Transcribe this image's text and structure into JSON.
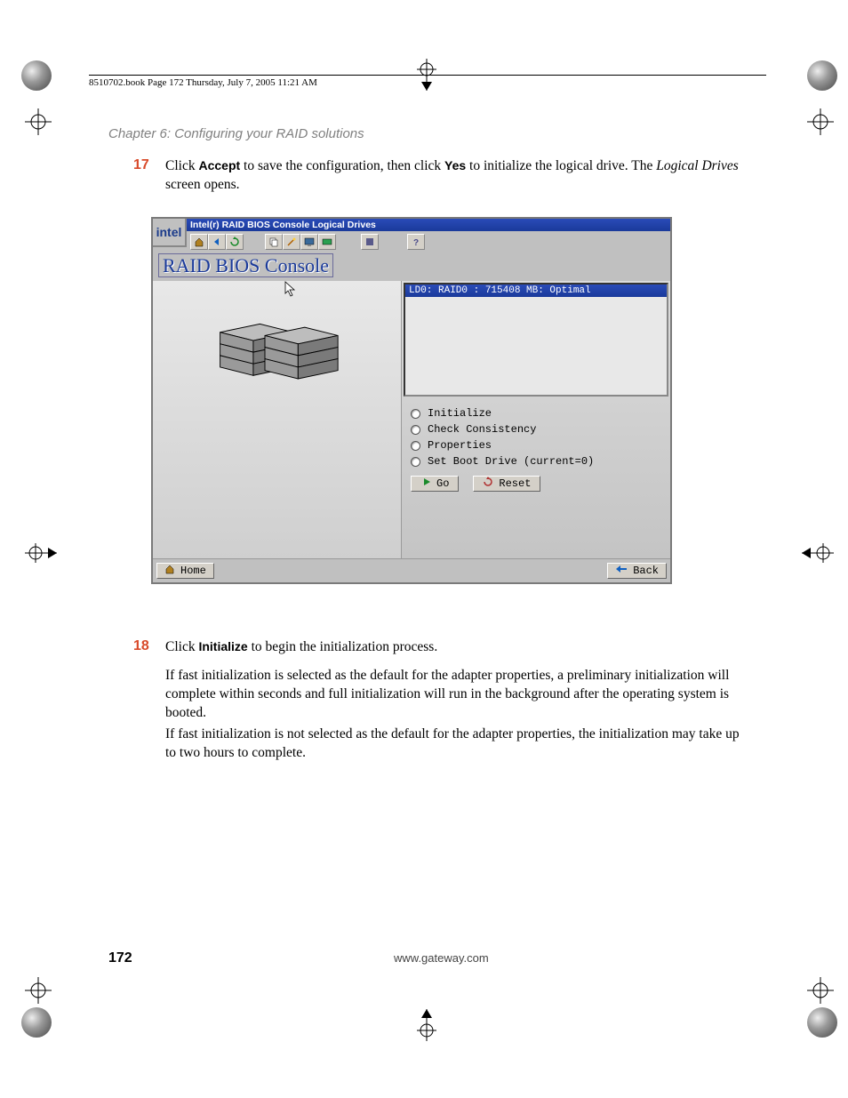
{
  "doc_header": "8510702.book  Page 172  Thursday, July 7, 2005  11:21 AM",
  "chapter_label": "Chapter 6: Configuring your RAID solutions",
  "step17": {
    "num": "17",
    "pre": "Click ",
    "accept": "Accept",
    "mid": " to save the configuration, then click ",
    "yes": "Yes",
    "post": " to initialize the logical drive. The ",
    "italic": "Logical Drives",
    "tail": " screen opens."
  },
  "screenshot": {
    "logo_text": "intel",
    "titlebar": "Intel(r) RAID BIOS Console  Logical Drives",
    "heading": "RAID BIOS Console",
    "ld_entry": "LD0: RAID0 : 715408 MB: Optimal",
    "options": [
      "Initialize",
      "Check Consistency",
      "Properties",
      "Set Boot Drive (current=0)"
    ],
    "go_btn": "Go",
    "reset_btn": "Reset",
    "home_btn": "Home",
    "back_btn": "Back"
  },
  "step18": {
    "num": "18",
    "pre": "Click ",
    "init": "Initialize",
    "post": " to begin the initialization process."
  },
  "para_fast": "If fast initialization is selected as the default for the adapter properties, a preliminary initialization will complete within seconds and full initialization will run in the background after the operating system is booted.",
  "para_slow": "If fast initialization is not selected as the default for the adapter properties, the initialization may take up to two hours to complete.",
  "footer": {
    "page": "172",
    "url": "www.gateway.com"
  }
}
